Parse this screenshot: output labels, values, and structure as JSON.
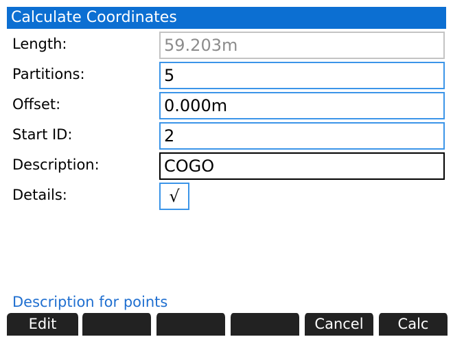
{
  "title": "Calculate Coordinates",
  "fields": {
    "length": {
      "label": "Length:",
      "value": "59.203m"
    },
    "partitions": {
      "label": "Partitions:",
      "value": "5"
    },
    "offset": {
      "label": "Offset:",
      "value": "0.000m"
    },
    "start_id": {
      "label": "Start ID:",
      "value": "2"
    },
    "description": {
      "label": "Description:",
      "value": "COGO"
    },
    "details": {
      "label": "Details:",
      "checked_glyph": "√"
    }
  },
  "help_text": "Description for points",
  "softkeys": [
    "Edit",
    "",
    "",
    "",
    "Cancel",
    "Calc"
  ],
  "colors": {
    "title_bar": "#0c6fd2",
    "field_border": "#3a94e8",
    "active_border": "#000000",
    "disabled_border": "#c3c3c3",
    "help_text": "#1f6fd0",
    "softkey_bg": "#222222"
  }
}
